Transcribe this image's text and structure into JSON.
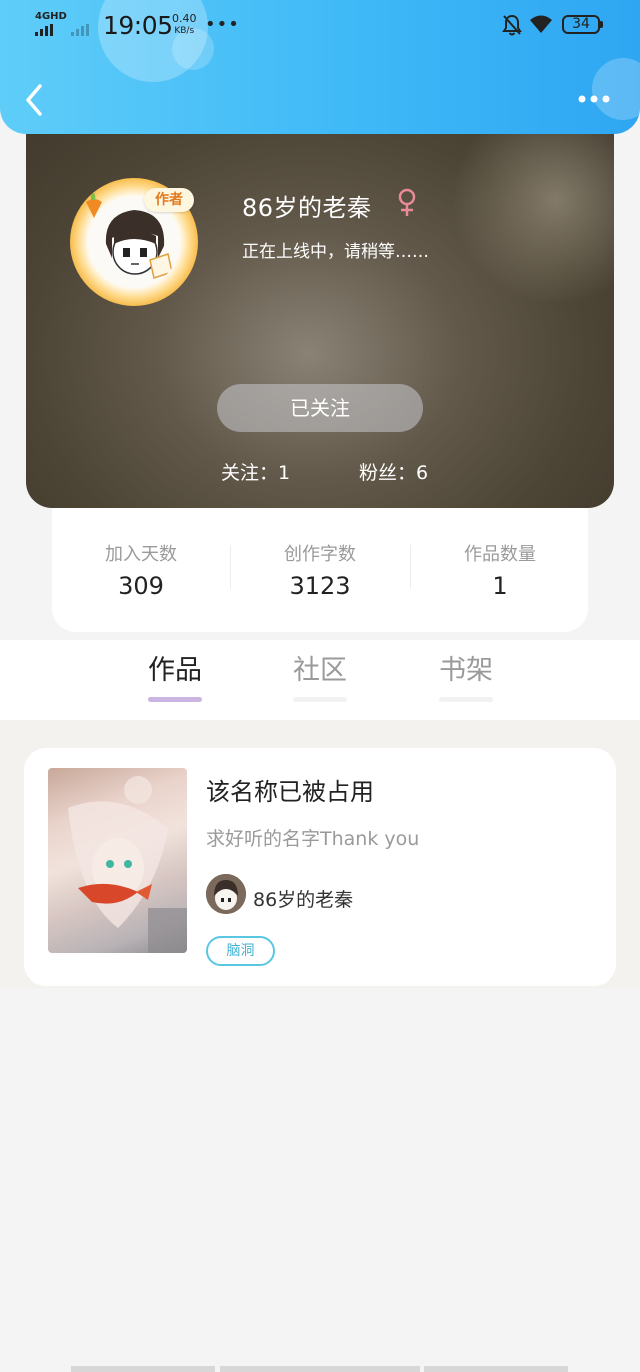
{
  "status_bar": {
    "network": "4GHD",
    "time": "19:05",
    "speed": "0.40",
    "speed_unit": "KB/s",
    "more": "•••",
    "battery": "34"
  },
  "header": {
    "back_icon": "chevron-left-icon",
    "more_icon": "more-dots-icon"
  },
  "profile": {
    "author_badge": "作者",
    "username": "86岁的老秦",
    "gender_icon": "female-icon",
    "bio": "正在上线中，请稍等……",
    "follow_button": "已关注",
    "following": "关注：1",
    "followers": "粉丝：6"
  },
  "stats": [
    {
      "label": "加入天数",
      "value": "309"
    },
    {
      "label": "创作字数",
      "value": "3123"
    },
    {
      "label": "作品数量",
      "value": "1"
    }
  ],
  "tabs": [
    {
      "label": "作品",
      "active": true
    },
    {
      "label": "社区",
      "active": false
    },
    {
      "label": "书架",
      "active": false
    }
  ],
  "work": {
    "title": "该名称已被占用",
    "description": "求好听的名字Thank you",
    "author": "86岁的老秦",
    "tag": "脑洞"
  },
  "colors": {
    "header_blue": "#3fb9f7",
    "active_tab_indicator": "#c9b4e2",
    "tag_cyan": "#5bc6e3",
    "gender_pink": "#e98a9b"
  }
}
